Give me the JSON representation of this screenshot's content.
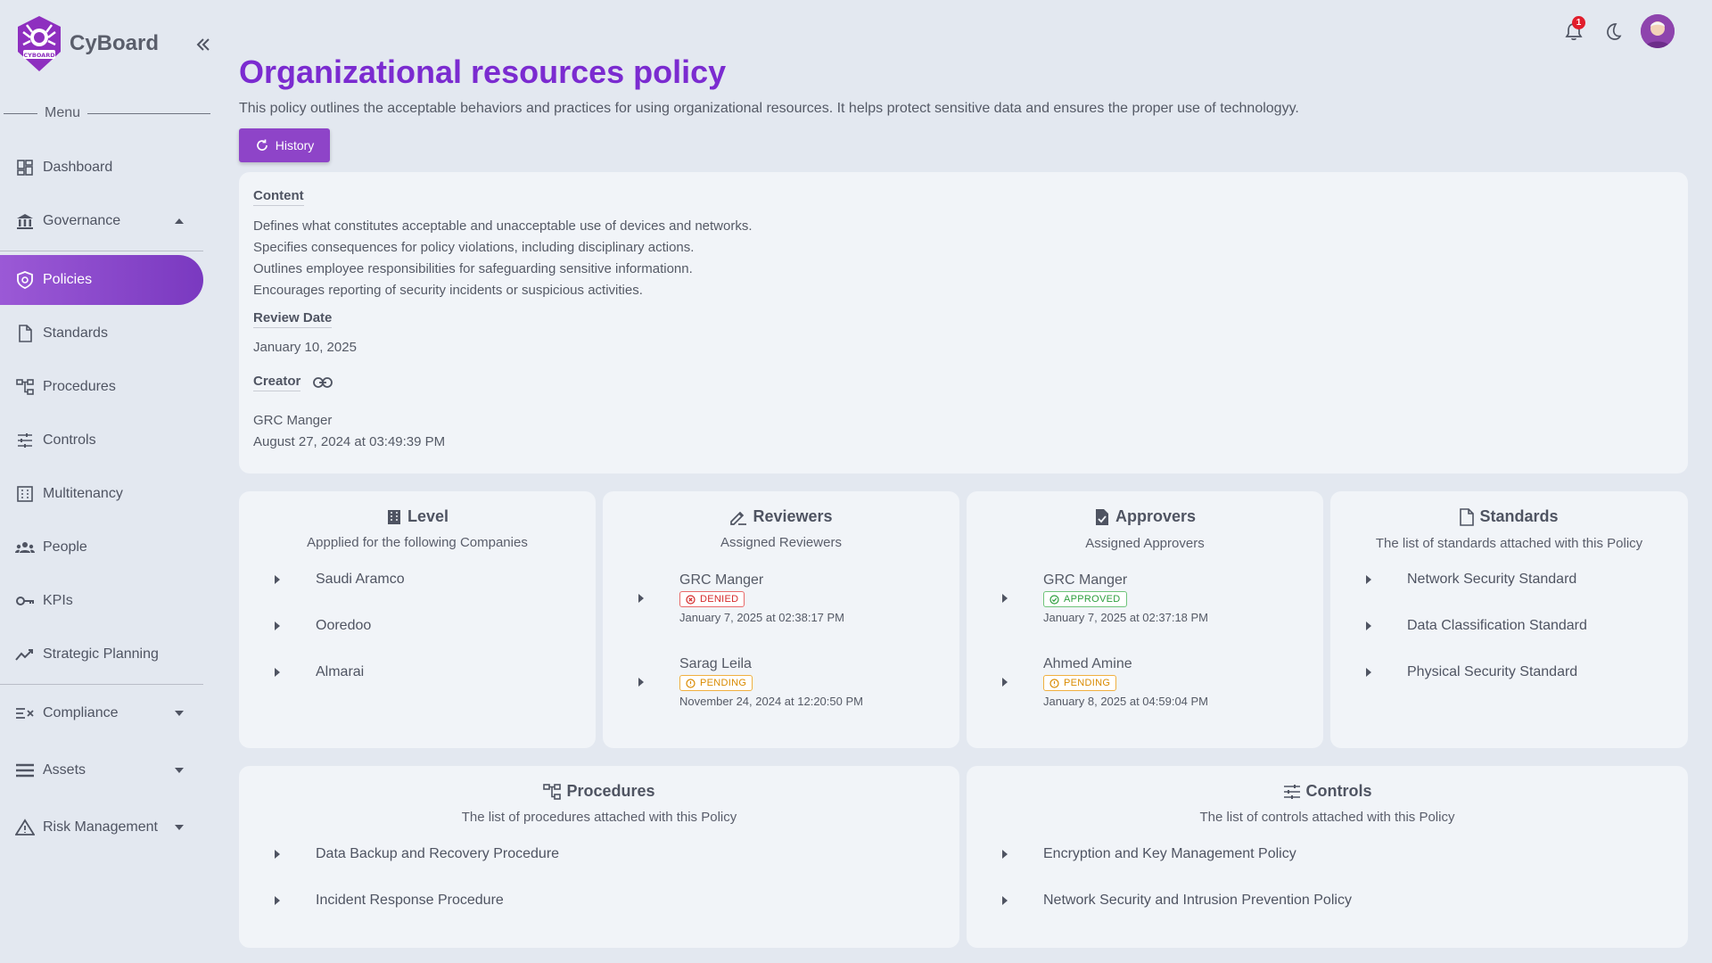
{
  "brand": {
    "name": "CyBoard",
    "logo_text": "CYBOARD"
  },
  "menu_label": "Menu",
  "sidebar": {
    "items": [
      {
        "label": "Dashboard",
        "icon": "dashboard-icon"
      },
      {
        "label": "Governance",
        "icon": "bank-icon",
        "expanded": true
      },
      {
        "label": "Policies",
        "icon": "shield-icon",
        "active": true
      },
      {
        "label": "Standards",
        "icon": "file-icon"
      },
      {
        "label": "Procedures",
        "icon": "tree-icon"
      },
      {
        "label": "Controls",
        "icon": "sliders-icon"
      },
      {
        "label": "Multitenancy",
        "icon": "building-icon"
      },
      {
        "label": "People",
        "icon": "people-icon"
      },
      {
        "label": "KPIs",
        "icon": "key-icon"
      },
      {
        "label": "Strategic Planning",
        "icon": "trend-icon"
      },
      {
        "label": "Compliance",
        "icon": "checklist-icon",
        "expanded": false
      },
      {
        "label": "Assets",
        "icon": "list-icon",
        "expanded": false
      },
      {
        "label": "Risk Management",
        "icon": "warning-icon",
        "expanded": false
      }
    ]
  },
  "header": {
    "notification_count": "1"
  },
  "page": {
    "title": "Organizational resources policy",
    "description": "This policy outlines the acceptable behaviors and practices for using organizational resources. It helps protect sensitive data and ensures the proper use of technologyy.",
    "history_label": "History"
  },
  "content": {
    "content_label": "Content",
    "lines": [
      "Defines what constitutes acceptable and unacceptable use of devices and networks.",
      "Specifies consequences for policy violations, including disciplinary actions.",
      "Outlines employee responsibilities for safeguarding sensitive informationn.",
      "Encourages reporting of security incidents or suspicious activities."
    ],
    "review_label": "Review Date",
    "review_date": "January 10, 2025",
    "creator_label": "Creator",
    "creator_name": "GRC Manger",
    "creator_date": "August 27, 2024 at 03:49:39 PM"
  },
  "level": {
    "title": "Level",
    "subtitle": "Appplied for the following Companies",
    "items": [
      "Saudi Aramco",
      "Ooredoo",
      "Almarai"
    ]
  },
  "reviewers": {
    "title": "Reviewers",
    "subtitle": "Assigned Reviewers",
    "items": [
      {
        "name": "GRC Manger",
        "status": "DENIED",
        "date": "January 7, 2025 at 02:38:17 PM"
      },
      {
        "name": "Sarag Leila",
        "status": "PENDING",
        "date": "November 24, 2024 at 12:20:50 PM"
      }
    ]
  },
  "approvers": {
    "title": "Approvers",
    "subtitle": "Assigned Approvers",
    "items": [
      {
        "name": "GRC Manger",
        "status": "APPROVED",
        "date": "January 7, 2025 at 02:37:18 PM"
      },
      {
        "name": "Ahmed Amine",
        "status": "PENDING",
        "date": "January 8, 2025 at 04:59:04 PM"
      }
    ]
  },
  "standards": {
    "title": "Standards",
    "subtitle": "The list of standards attached with this Policy",
    "items": [
      "Network Security Standard",
      "Data Classification Standard",
      "Physical Security Standard"
    ]
  },
  "procedures": {
    "title": "Procedures",
    "subtitle": "The list of procedures attached with this Policy",
    "items": [
      "Data Backup and Recovery Procedure",
      "Incident Response Procedure"
    ]
  },
  "controls": {
    "title": "Controls",
    "subtitle": "The list of controls attached with this Policy",
    "items": [
      "Encryption and Key Management Policy",
      "Network Security and Intrusion Prevention Policy"
    ]
  },
  "colors": {
    "accent": "#7b2bd0",
    "active_nav": "#8e44c8",
    "denied": "#d42a2a",
    "pending": "#d98a00",
    "approved": "#2e9e3e"
  }
}
